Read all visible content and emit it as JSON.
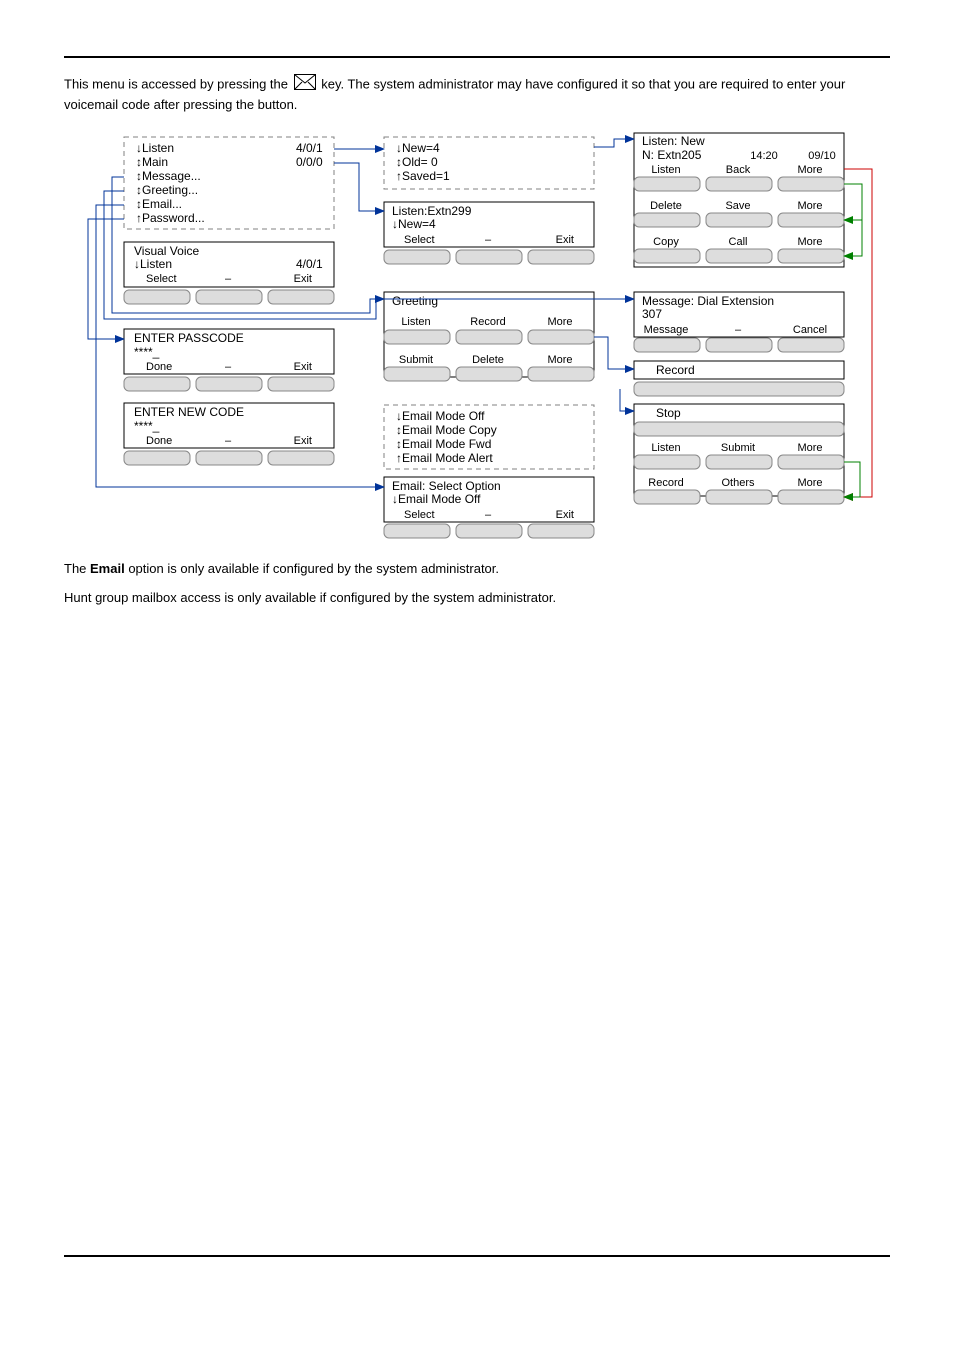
{
  "intro": {
    "before_icon": "This menu is accessed by pressing the ",
    "after_icon": " key. The system administrator may have configured it so that you are required to enter your voicemail code after pressing the button."
  },
  "paragraphs": {
    "email_note_a": "The ",
    "email_note_b": "Email",
    "email_note_c": " option is only available if configured by the system administrator.",
    "huntgroup_note": "Hunt group mailbox access is only available if configured by the system administrator."
  },
  "screens": {
    "main": {
      "items": [
        {
          "label": "↓Listen",
          "value": "4/0/1"
        },
        {
          "label": "↕Main",
          "value": "0/0/0"
        },
        {
          "label": "↕Message..."
        },
        {
          "label": "↕Greeting..."
        },
        {
          "label": "↕Email..."
        },
        {
          "label": "↑Password..."
        }
      ]
    },
    "visual_voice": {
      "title": "Visual Voice",
      "line": "↓Listen",
      "value": "4/0/1",
      "softkeys": [
        "Select",
        "–",
        "Exit"
      ]
    },
    "enter_passcode": {
      "title": "ENTER PASSCODE",
      "masked": "****_",
      "softkeys": [
        "Done",
        "–",
        "Exit"
      ]
    },
    "enter_newcode": {
      "title": "ENTER NEW CODE",
      "masked": "****_",
      "softkeys": [
        "Done",
        "–",
        "Exit"
      ]
    },
    "counts": {
      "items": [
        "↓New=4",
        "↕Old= 0",
        "↑Saved=1"
      ]
    },
    "listen_extn": {
      "title": "Listen:Extn299",
      "line": "↓New=4",
      "softkeys": [
        "Select",
        "–",
        "Exit"
      ]
    },
    "greeting": {
      "title": "Greeting",
      "row1": [
        "Listen",
        "Record",
        "More"
      ],
      "row2": [
        "Submit",
        "Delete",
        "More"
      ]
    },
    "email_modes": {
      "items": [
        "↓Email Mode Off",
        "↕Email Mode Copy",
        "↕Email Mode Fwd",
        "↑Email Mode Alert"
      ]
    },
    "email_select": {
      "title": "Email: Select Option",
      "line": "↓Email Mode Off",
      "softkeys": [
        "Select",
        "–",
        "Exit"
      ]
    },
    "listen_new": {
      "title": "Listen: New",
      "info": "N: Extn205",
      "time": "14:20",
      "date": "09/10",
      "row1": [
        "Listen",
        "Back",
        "More"
      ],
      "row2": [
        "Delete",
        "Save",
        "More"
      ],
      "row3": [
        "Copy",
        "Call",
        "More"
      ]
    },
    "message_dial": {
      "title": "Message: Dial Extension",
      "line": "307",
      "softkeys": [
        "Message",
        "–",
        "Cancel"
      ]
    },
    "record": {
      "title": "Record"
    },
    "stop": {
      "title": "Stop",
      "row1": [
        "Listen",
        "Submit",
        "More"
      ],
      "row2": [
        "Record",
        "Others",
        "More"
      ]
    }
  }
}
